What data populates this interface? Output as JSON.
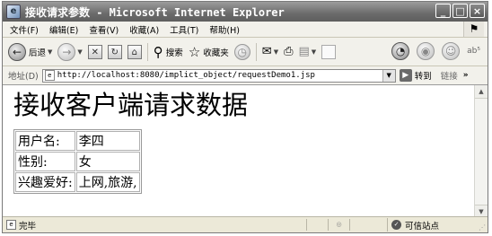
{
  "window": {
    "title": "接收请求参数 - Microsoft Internet Explorer",
    "controls": {
      "minimize": "_",
      "maximize": "□",
      "close": "×"
    }
  },
  "menu": {
    "items": [
      {
        "label": "文件(F)"
      },
      {
        "label": "编辑(E)"
      },
      {
        "label": "查看(V)"
      },
      {
        "label": "收藏(A)"
      },
      {
        "label": "工具(T)"
      },
      {
        "label": "帮助(H)"
      }
    ]
  },
  "toolbar": {
    "back_label": "后退",
    "search_label": "搜索",
    "favorites_label": "收藏夹",
    "back_icon": "back-arrow-icon",
    "forward_icon": "forward-arrow-icon",
    "stop_icon": "stop-icon",
    "refresh_icon": "refresh-icon",
    "home_icon": "home-icon"
  },
  "address": {
    "label": "地址(D)",
    "url": "http://localhost:8080/implict_object/requestDemo1.jsp",
    "go_label": "转到",
    "links_label": "链接"
  },
  "page": {
    "heading": "接收客户端请求数据",
    "rows": [
      {
        "label": "用户名:",
        "value": "李四"
      },
      {
        "label": "性别:",
        "value": "女"
      },
      {
        "label": "兴趣爱好:",
        "value": "上网,旅游,"
      }
    ]
  },
  "status": {
    "text": "完毕",
    "zone": "可信站点"
  },
  "colors": {
    "titlebar": "#6b6b6b",
    "chrome": "#ece9d8",
    "content_bg": "#ffffff"
  }
}
